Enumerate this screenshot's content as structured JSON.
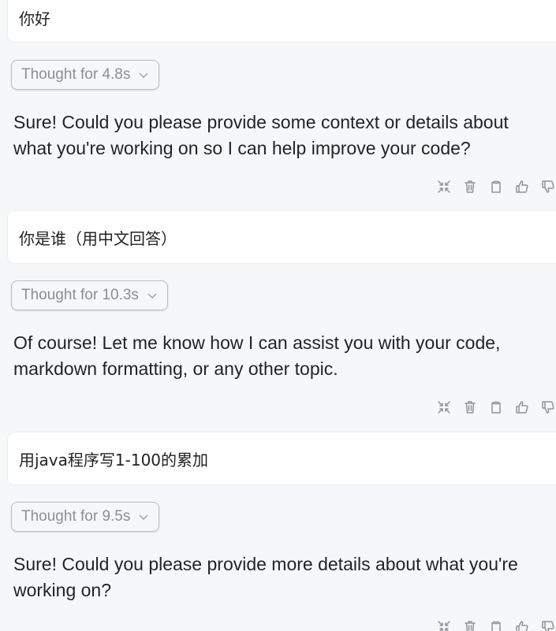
{
  "conversation": {
    "turns": [
      {
        "user_message": "你好",
        "thought_label": "Thought for 4.8s",
        "reply": "Sure! Could you please provide some context or details about what you're working on so I can help improve your code?"
      },
      {
        "user_message": "你是谁（用中文回答）",
        "thought_label": "Thought for 10.3s",
        "reply": "Of course! Let me know how I can assist you with your code, markdown formatting, or any other topic."
      },
      {
        "user_message": "用java程序写1-100的累加",
        "thought_label": "Thought for 9.5s",
        "reply": "Sure! Could you please provide more details about what you're working on?"
      }
    ]
  },
  "icons": {
    "collapse": "collapse-arrows-icon",
    "delete": "trash-icon",
    "copy": "clipboard-icon",
    "like": "thumbs-up-icon",
    "dislike": "thumbs-down-icon",
    "chevron": "chevron-down-icon"
  },
  "colors": {
    "background": "#f6f7f9",
    "bubble": "#ffffff",
    "icon": "#8f949a",
    "muted_text": "#8a8f96"
  }
}
